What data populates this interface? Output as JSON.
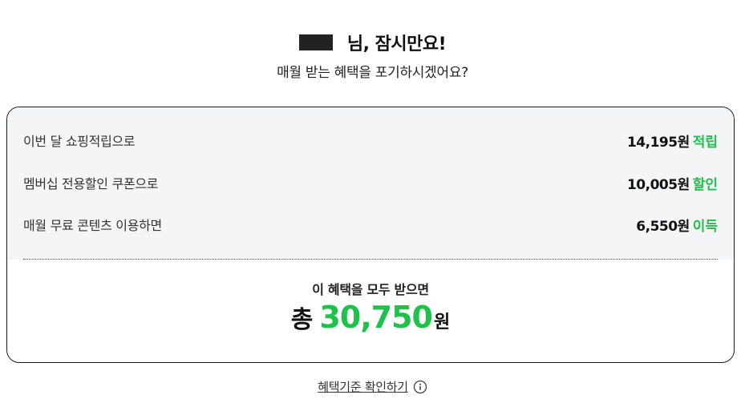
{
  "header": {
    "greeting": "님, 잠시만요!",
    "subtitle": "매월 받는 혜택을 포기하시겠어요?"
  },
  "benefits": [
    {
      "label": "이번 달 쇼핑적립으로",
      "value": "14,195원",
      "suffix": "적립"
    },
    {
      "label": "멤버십 전용할인 쿠폰으로",
      "value": "10,005원",
      "suffix": "할인"
    },
    {
      "label": "매월 무료 콘텐츠 이용하면",
      "value": "6,550원",
      "suffix": "이득"
    }
  ],
  "total": {
    "caption": "이 혜택을 모두 받으면",
    "prefix": "총",
    "amount": "30,750",
    "unit": "원"
  },
  "footer": {
    "link_label": "혜택기준 확인하기",
    "icon": "info-icon"
  },
  "colors": {
    "accent": "#1ec24a",
    "panel_bg": "#f4f5f7",
    "border": "#1a1a1a"
  }
}
